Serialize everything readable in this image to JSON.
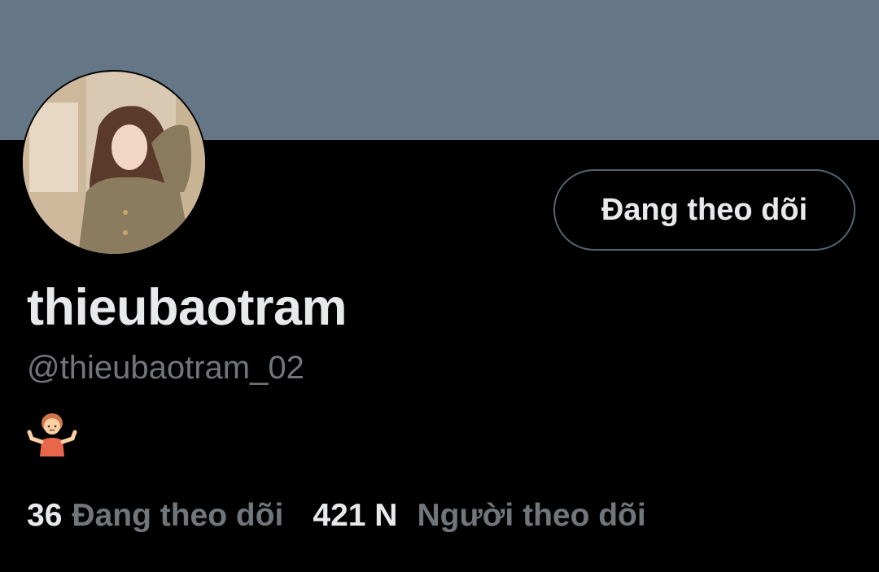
{
  "profile": {
    "display_name": "thieubaotram",
    "handle": "@thieubaotram_02",
    "bio_emoji": "person-shrugging-emoji",
    "avatar_icon": "profile-photo"
  },
  "actions": {
    "follow_label": "Đang theo dõi"
  },
  "stats": {
    "following_count": "36",
    "following_label": "Đang theo dõi",
    "followers_count": "421 N",
    "followers_label": "Người theo dõi"
  },
  "colors": {
    "banner": "#657786",
    "background": "#000000",
    "primary_text": "#e7e9ea",
    "secondary_text": "#71767b"
  }
}
